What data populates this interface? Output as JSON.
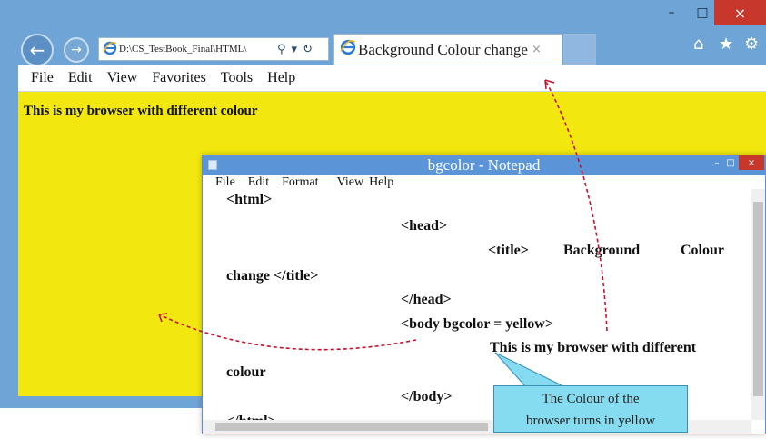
{
  "browser": {
    "address_url": "D:\\CS_TestBook_Final\\HTML\\",
    "tab_title": "Background Colour change",
    "tab_close": "×",
    "window_controls": {
      "minimize": "–",
      "maximize": "□",
      "close": "×"
    },
    "nav": {
      "back_icon": "←",
      "forward_icon": "→",
      "search_icon": "⚲",
      "dropdown_icon": "▾",
      "refresh_icon": "↻"
    },
    "right_icons": {
      "home": "⌂",
      "favorites": "★",
      "settings": "⚙"
    },
    "menu": [
      "File",
      "Edit",
      "View",
      "Favorites",
      "Tools",
      "Help"
    ],
    "page_text": "This is my browser with different colour",
    "page_background": "#f2e80f"
  },
  "notepad": {
    "title": "bgcolor - Notepad",
    "window_controls": {
      "minimize": "–",
      "maximize": "□",
      "close": "×"
    },
    "menu": [
      "File",
      "Edit",
      "Format",
      "View",
      "Help"
    ],
    "code": {
      "html_open": "<html>",
      "head_open": "<head>",
      "title_tag": "<title>",
      "title_word1": "Background",
      "title_word2": "Colour",
      "title_close": "change </title>",
      "head_close": "</head>",
      "body_open": "<body bgcolor = yellow>",
      "body_text": "This is my browser with different",
      "body_text2": "colour",
      "body_close": "</body>",
      "html_close": "</html>"
    }
  },
  "callout": {
    "line1": "The Colour of the",
    "line2": "browser turns in yellow"
  },
  "colors": {
    "ie_frame": "#6fa4d6",
    "notepad_title": "#5b95d8",
    "callout_fill": "#85dcf0",
    "arrow": "#c8102e"
  }
}
